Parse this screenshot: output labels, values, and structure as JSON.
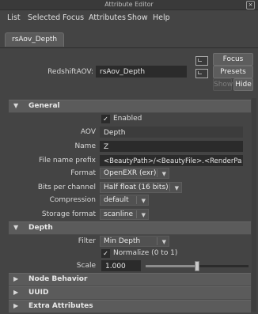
{
  "window": {
    "title": "Attribute Editor",
    "close_glyph": "×"
  },
  "menu": [
    "List",
    "Selected",
    "Focus",
    "Attributes",
    "Show",
    "Help"
  ],
  "tab": {
    "label": "rsAov_Depth"
  },
  "node": {
    "type_label": "RedshiftAOV:",
    "name_value": "rsAov_Depth",
    "focus_label": "Focus",
    "presets_label": "Presets",
    "show_label": "Show",
    "hide_label": "Hide"
  },
  "general": {
    "title": "General",
    "toggle_glyph": "▼",
    "enabled_label": "Enabled",
    "enabled_checked": true,
    "check_glyph": "✓",
    "aov_label": "AOV",
    "aov_value": "Depth",
    "name_label": "Name",
    "name_value": "Z",
    "prefix_label": "File name prefix",
    "prefix_value": "<BeautyPath>/<BeautyFile>.<RenderPass>",
    "format_label": "Format",
    "format_value": "OpenEXR (exr)",
    "bits_label": "Bits per channel",
    "bits_value": "Half float (16 bits)",
    "compression_label": "Compression",
    "compression_value": "default",
    "storage_label": "Storage format",
    "storage_value": "scanline"
  },
  "depth": {
    "title": "Depth",
    "toggle_glyph": "▼",
    "filter_label": "Filter",
    "filter_value": "Min Depth",
    "normalize_label": "Normalize (0 to 1)",
    "normalize_checked": true,
    "scale_label": "Scale",
    "scale_value": "1.000",
    "scale_slider_fraction": 0.5
  },
  "collapsed_frames": [
    {
      "title": "Node Behavior",
      "toggle_glyph": "▶"
    },
    {
      "title": "UUID",
      "toggle_glyph": "▶"
    },
    {
      "title": "Extra Attributes",
      "toggle_glyph": "▶"
    }
  ],
  "dropdown_arrow": "▼"
}
